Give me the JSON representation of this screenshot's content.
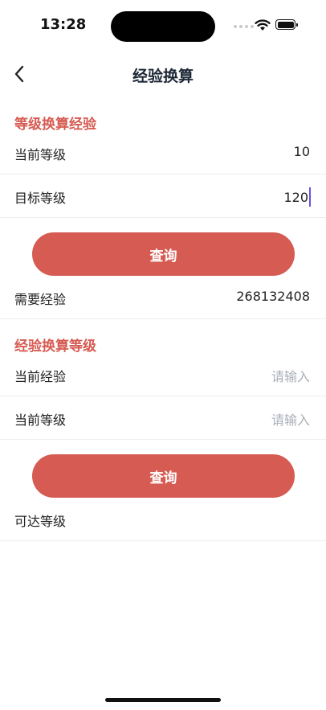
{
  "status": {
    "time": "13:28"
  },
  "nav": {
    "title": "经验换算"
  },
  "section1": {
    "title": "等级换算经验",
    "current_level_label": "当前等级",
    "current_level_value": "10",
    "target_level_label": "目标等级",
    "target_level_value": "120",
    "query_label": "查询",
    "result_label": "需要经验",
    "result_value": "268132408"
  },
  "section2": {
    "title": "经验换算等级",
    "current_exp_label": "当前经验",
    "current_exp_placeholder": "请输入",
    "current_level_label": "当前等级",
    "current_level_placeholder": "请输入",
    "query_label": "查询",
    "result_label": "可达等级",
    "result_value": ""
  },
  "colors": {
    "accent": "#d65b52",
    "placeholder": "#a9afb8",
    "caret": "#6d4fe0"
  }
}
